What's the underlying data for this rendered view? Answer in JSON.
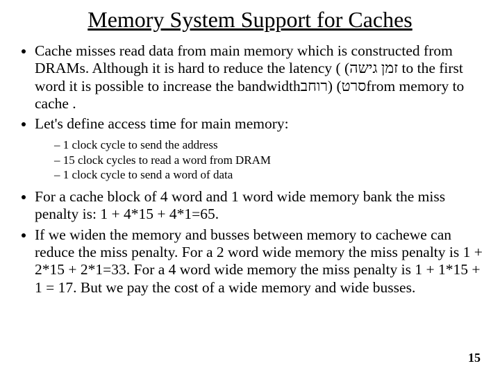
{
  "title": "Memory System Support for Caches",
  "bullets": {
    "b1": "Cache misses read data from main memory which is constructed from DRAMs. Although it is hard to reduce the latency ( (זמן גישה to the first word it is possible to increase the bandwidthרוחב) (סרטfrom memory to cache .",
    "b2": "Let's define access time for main memory:",
    "sub1": "1 clock cycle to send the address",
    "sub2": "15 clock cycles to read a word from DRAM",
    "sub3": "1 clock cycle to send a word of data",
    "b3": "For a cache block of 4 word and 1  word wide memory bank the miss penalty is: 1 + 4*15 + 4*1=65.",
    "b4": "If we widen the memory and busses between memory to cachewe can reduce the miss penalty. For a 2 word wide memory the miss penalty is 1 + 2*15 + 2*1=33. For a 4 word wide memory the miss penalty is 1 + 1*15 + 1 = 17. But we pay the cost of a wide memory and wide busses."
  },
  "page_number": "15"
}
